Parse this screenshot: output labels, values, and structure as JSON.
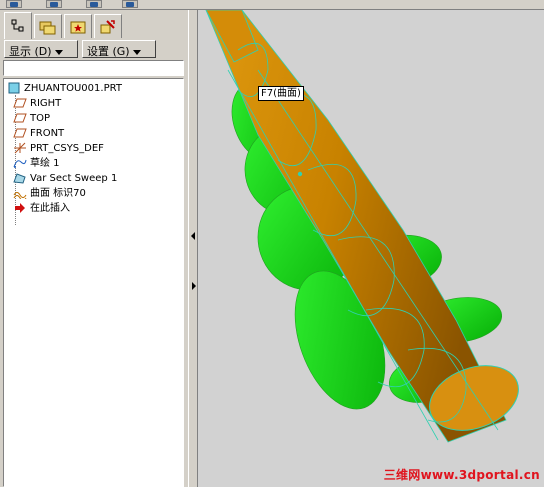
{
  "toolbar": {
    "buttons": [
      "eye-icon",
      "eye-icon",
      "eye-icon",
      "eye-icon"
    ]
  },
  "tabs": [
    {
      "name": "model-tree-tab",
      "icon": "tree-icon",
      "active": true
    },
    {
      "name": "folder-browser-tab",
      "icon": "folders-icon",
      "active": false
    },
    {
      "name": "favorites-tab",
      "icon": "star-folder-icon",
      "active": false
    },
    {
      "name": "connections-tab",
      "icon": "connections-icon",
      "active": false
    }
  ],
  "menus": {
    "show_label": "显示 (D)",
    "settings_label": "设置 (G)"
  },
  "tree": {
    "root": "ZHUANTOU001.PRT",
    "items": [
      {
        "label": "RIGHT",
        "icon": "datum-plane-icon"
      },
      {
        "label": "TOP",
        "icon": "datum-plane-icon"
      },
      {
        "label": "FRONT",
        "icon": "datum-plane-icon"
      },
      {
        "label": "PRT_CSYS_DEF",
        "icon": "coordinate-system-icon"
      },
      {
        "label": "草绘 1",
        "icon": "sketch-icon"
      },
      {
        "label": "Var Sect Sweep 1",
        "icon": "sweep-icon"
      },
      {
        "label": "曲面 标识70",
        "icon": "surface-icon"
      },
      {
        "label": "在此插入",
        "icon": "insert-here-icon"
      }
    ]
  },
  "viewport": {
    "tooltip": "F7(曲面)",
    "watermark": "三维网www.3dportal.cn"
  },
  "colors": {
    "shaft": "#c88a00",
    "flute": "#18e018",
    "edge": "#30d0b0",
    "background": "#d2d2d2",
    "watermark": "#e0141e"
  }
}
